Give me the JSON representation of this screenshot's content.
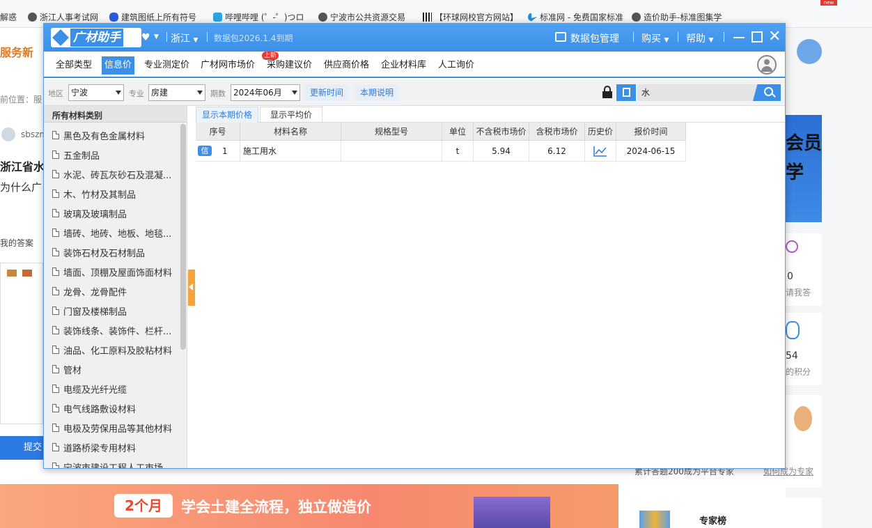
{
  "bookmarks": [
    {
      "label": "解惑",
      "icon": "none"
    },
    {
      "label": "浙江人事考试网",
      "icon": "globe-icon"
    },
    {
      "label": "建筑图纸上所有符号",
      "icon": "paw-icon"
    },
    {
      "label": "哔哩哔哩 (゜-゜)つロ",
      "icon": "bilibili-icon"
    },
    {
      "label": "宁波市公共资源交易",
      "icon": "globe-icon"
    },
    {
      "label": "【环球网校官方网站】",
      "icon": "qr-icon"
    },
    {
      "label": "标准网 - 免费国家标准",
      "icon": "bing-icon"
    },
    {
      "label": "造价助手-标准图集学",
      "icon": "globe-icon"
    }
  ],
  "bookmarks_new_badge": "new",
  "background_page": {
    "logo_text": "服务新",
    "breadcrumb": "前位置：服",
    "user": "sbszm",
    "question_title": "浙江省水",
    "question_sub": "为什么广",
    "my_answer_label": "我的答案",
    "submit_button": "提交",
    "member_banner_line1": "会员",
    "member_banner_line2": "学",
    "stat1_value": "0",
    "stat1_label": "请我答",
    "stat2_value": "54",
    "stat2_label": "的积分",
    "expert_promo": "累计答题200成为平台专家",
    "become_expert_link": "如何成为专家",
    "expert_rank": "专家榜",
    "banner_badge": "2个月",
    "banner_text": "学会土建全流程，独立做造价"
  },
  "dialog": {
    "logo_text": "广材助手",
    "region": "浙江",
    "package_expiry": "数据包2026.1.4到期",
    "package_manage": "数据包管理",
    "buy": "购买",
    "help": "帮助",
    "tabs": [
      "全部类型",
      "信息价",
      "专业测定价",
      "广材网市场价",
      "采购建议价",
      "供应商价格",
      "企业材料库",
      "人工询价"
    ],
    "active_tab": 1,
    "new_badge": "上新",
    "filters": {
      "area_label": "地区",
      "area_value": "宁波",
      "major_label": "专业",
      "major_value": "房建",
      "period_label": "期数",
      "period_value": "2024年06月",
      "update_time": "更新时间",
      "period_note": "本期说明",
      "search_value": "水"
    },
    "sidebar_header": "所有材料类别",
    "categories": [
      "黑色及有色金属材料",
      "五金制品",
      "水泥、砖瓦灰砂石及混凝...",
      "木、竹材及其制品",
      "玻璃及玻璃制品",
      "墙砖、地砖、地板、地毯...",
      "装饰石材及石材制品",
      "墙面、顶棚及屋面饰面材料",
      "龙骨、龙骨配件",
      "门窗及楼梯制品",
      "装饰线条、装饰件、栏杆...",
      "油品、化工原料及胶粘材料",
      "管材",
      "电缆及光纤光缆",
      "电气线路敷设材料",
      "电极及劳保用品等其他材料",
      "道路桥梁专用材料",
      "宁波市建设工程人工市场..."
    ],
    "subtabs": [
      "显示本期价格",
      "显示平均价"
    ],
    "active_subtab": 0,
    "columns": [
      "序号",
      "材料名称",
      "规格型号",
      "单位",
      "不含税市场价",
      "含税市场价",
      "历史价",
      "报价时间"
    ],
    "rows": [
      {
        "badge": "信",
        "index": "1",
        "name": "施工用水",
        "spec": "",
        "unit": "t",
        "price_ex_tax": "5.94",
        "price_in_tax": "6.12",
        "history": "chart-icon",
        "date": "2024-06-15"
      }
    ]
  }
}
